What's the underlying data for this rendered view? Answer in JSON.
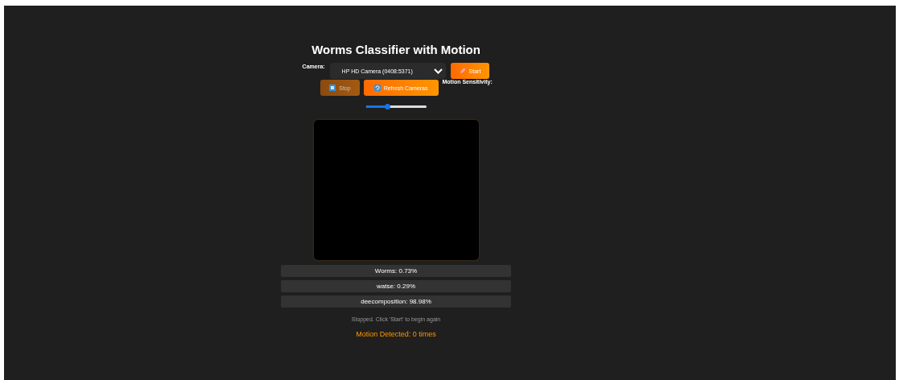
{
  "title": "Worms Classifier with Motion",
  "camera": {
    "label": "Camera:",
    "value": "HP HD Camera (0408:5371)"
  },
  "buttons": [
    {
      "kind": "start",
      "label": "Start",
      "disabled": false
    },
    {
      "kind": "stop",
      "label": "Stop",
      "disabled": true
    },
    {
      "kind": "refresh",
      "label": "Refresh Cameras",
      "disabled": false
    }
  ],
  "sensitivity": {
    "label": "Motion Sensitivity:",
    "level": 0.35
  },
  "predictions": [
    "Worms: 0.73%",
    "watse: 0.29%",
    "deecomposition: 98.98%"
  ],
  "status": "Stopped. Click 'Start' to begin again",
  "motion": "Motion Detected: 0 times"
}
